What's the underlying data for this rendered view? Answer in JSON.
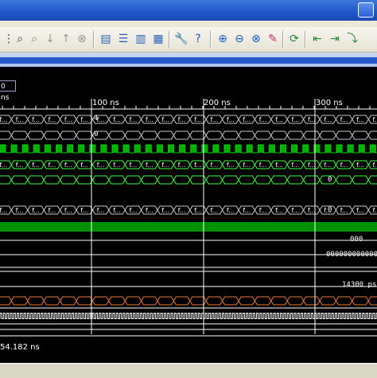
{
  "waveform": {
    "cursor_value": "0 ns",
    "time_ticks": [
      "100 ns",
      "200 ns",
      "300 ns"
    ],
    "bus_label": "f...",
    "row_values": {
      "bus_a_prefix": "4",
      "bus_b_prefix": "0",
      "bus_d_end": "0",
      "bus_e_end": "0",
      "value_000": "000",
      "value_zeros": "000000000000",
      "value_ps": "14300 ps"
    },
    "status_time": "54.182 ns"
  },
  "colors": {
    "bus": "#c8c8c8",
    "green": "#00d000",
    "bright_green": "#40ff40",
    "orange": "#e8783a",
    "white": "#ffffff",
    "cursor": "#ffffff"
  },
  "toolbar": {
    "icons": [
      "find-icon",
      "find-next-icon",
      "down-arrow-icon",
      "up-arrow-icon",
      "cancel-icon",
      "window-cascade-icon",
      "window-tile-h-icon",
      "window-tile-v-icon",
      "window-arrange-icon",
      "settings-icon",
      "help-icon",
      "zoom-in-icon",
      "zoom-out-icon",
      "zoom-fit-icon",
      "zoom-area-icon",
      "refresh-icon",
      "back-icon",
      "forward-icon",
      "step-icon"
    ]
  }
}
